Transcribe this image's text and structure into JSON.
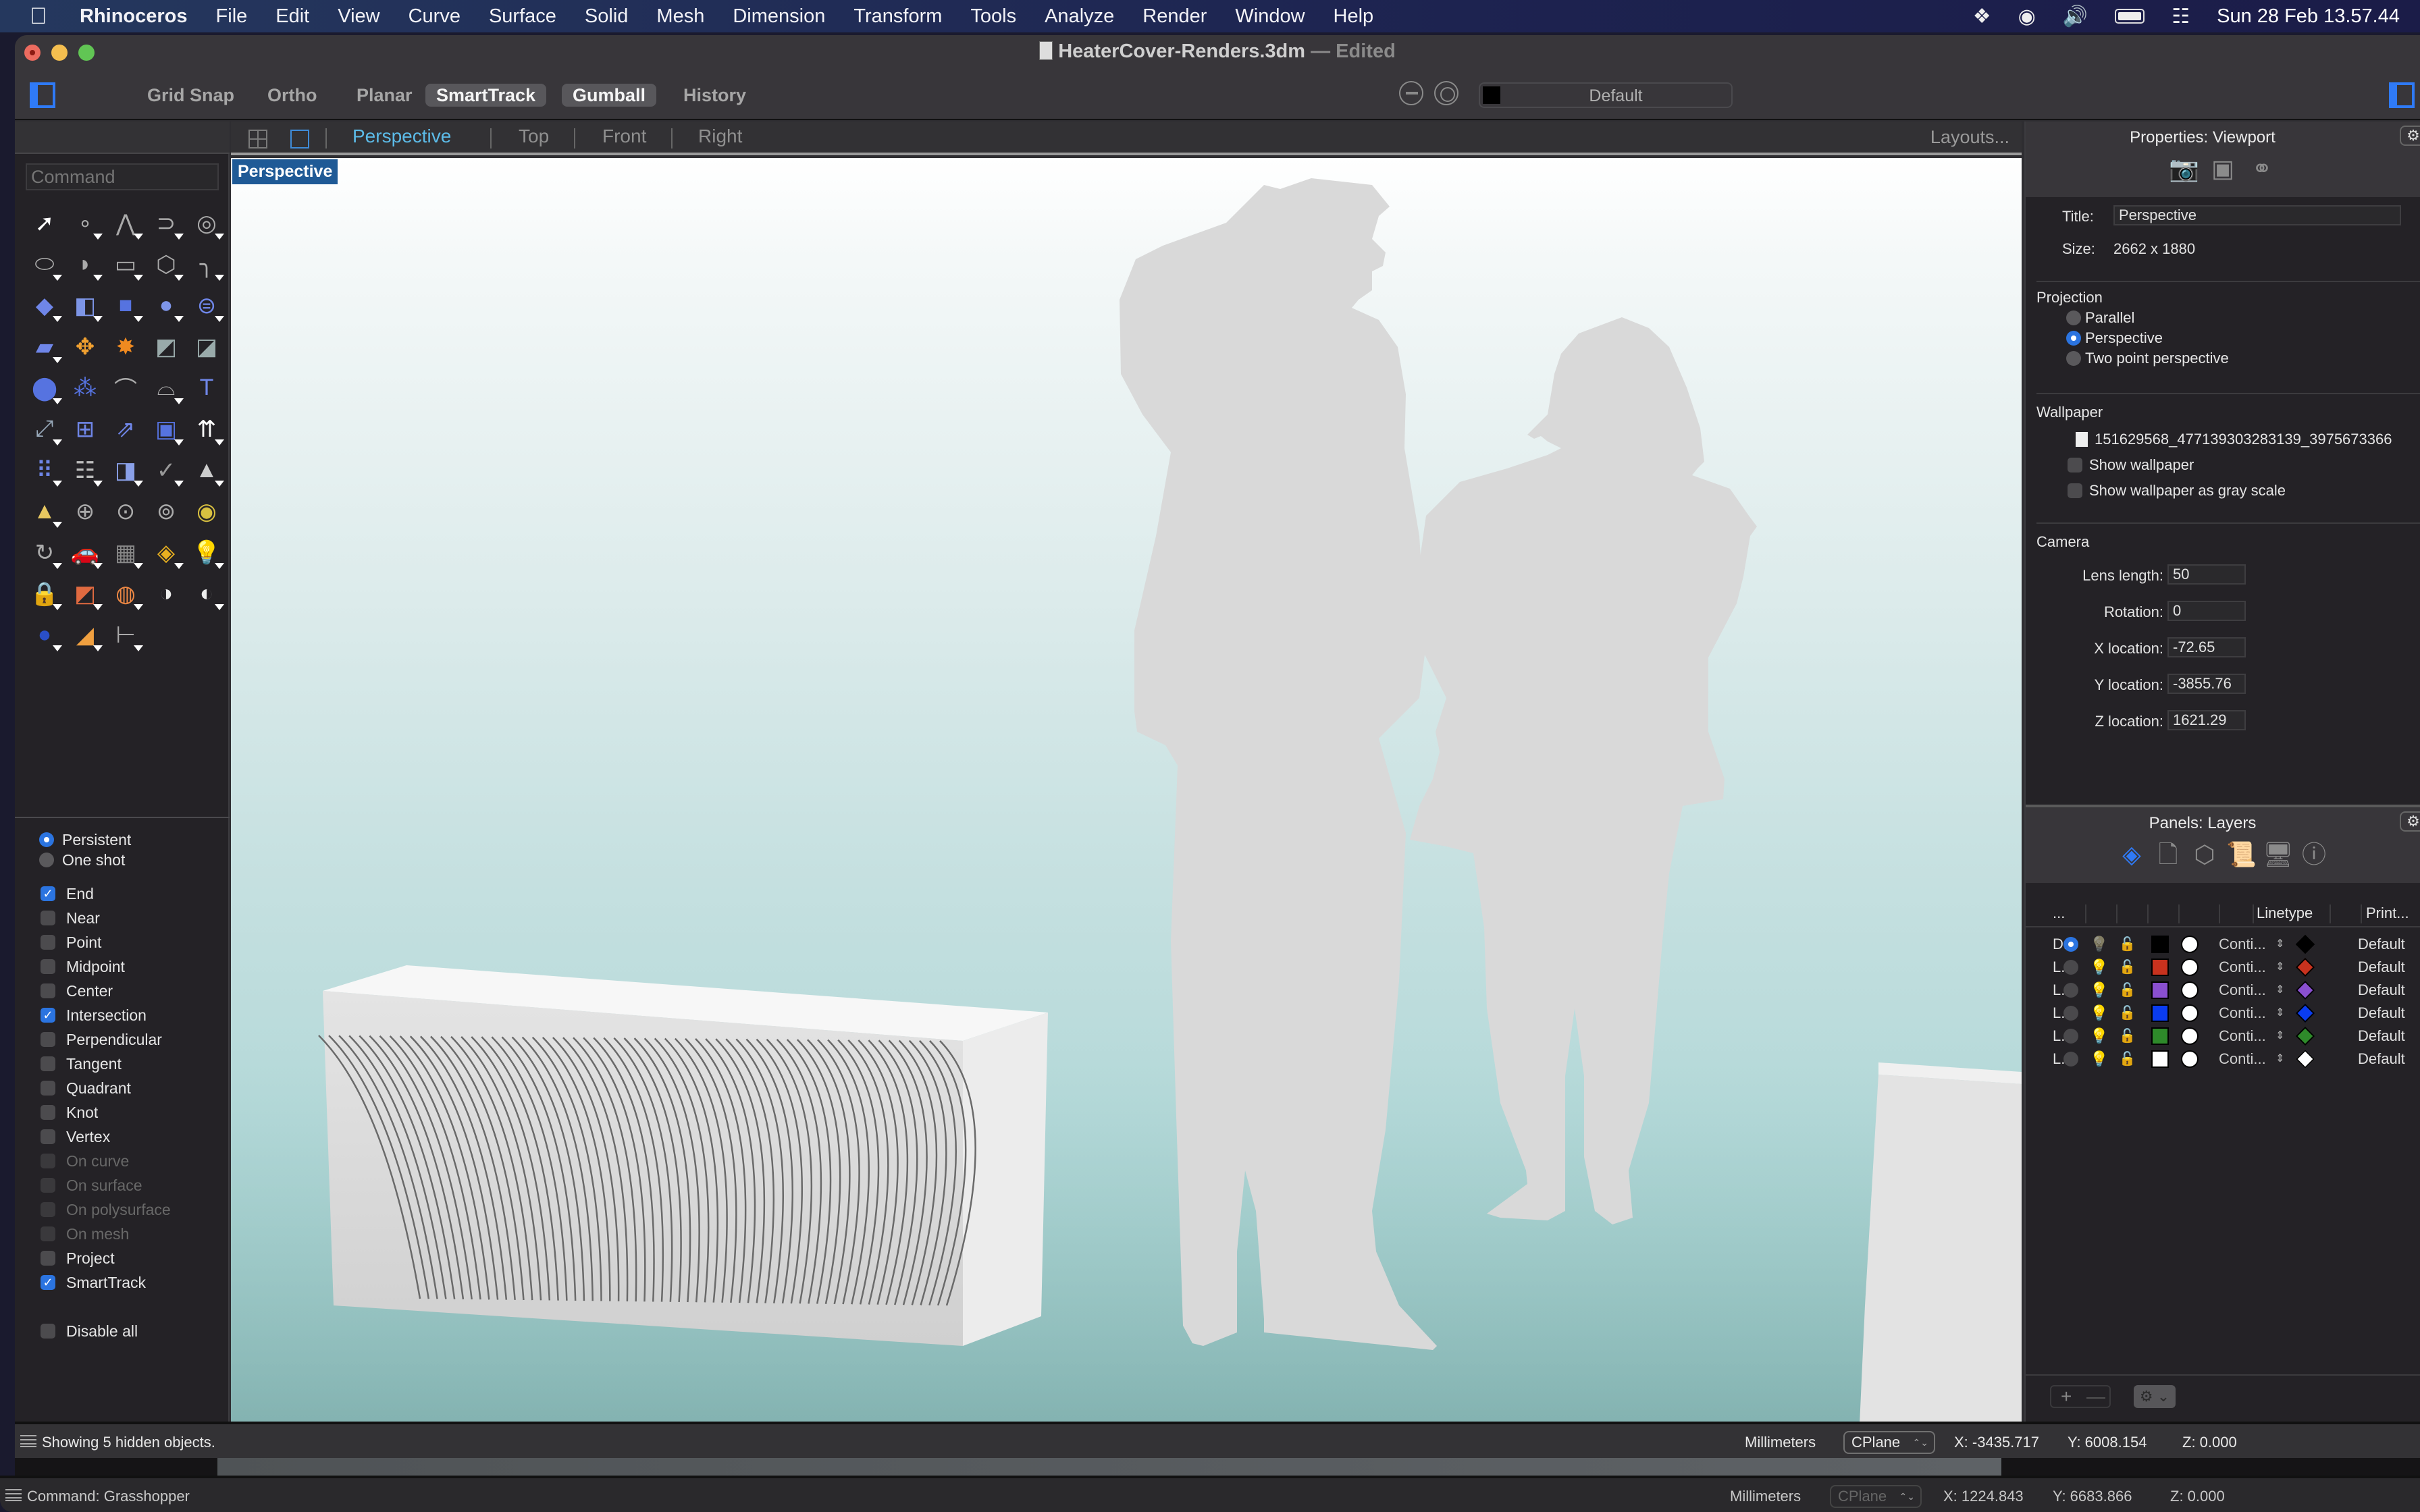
{
  "menubar": {
    "app_name": "Rhinoceros",
    "items": [
      "File",
      "Edit",
      "View",
      "Curve",
      "Surface",
      "Solid",
      "Mesh",
      "Dimension",
      "Transform",
      "Tools",
      "Analyze",
      "Render",
      "Window",
      "Help"
    ],
    "status_icons": [
      "dropbox-icon",
      "hand-mirror-icon",
      "volume-icon",
      "battery-icon",
      "control-center-icon"
    ],
    "clock": "Sun 28 Feb  13.57.44"
  },
  "window": {
    "title": "HeaterCover-Renders.3dm",
    "title_separator": "—",
    "status": "Edited"
  },
  "toolbar": {
    "toggles": [
      {
        "label": "Grid Snap",
        "on": false
      },
      {
        "label": "Ortho",
        "on": false
      },
      {
        "label": "Planar",
        "on": false
      },
      {
        "label": "SmartTrack",
        "on": true
      },
      {
        "label": "Gumball",
        "on": true
      },
      {
        "label": "History",
        "on": false
      }
    ],
    "current_layer": "Default",
    "current_layer_color": "#000000"
  },
  "command": {
    "placeholder": "Command"
  },
  "tool_palette": [
    "select-arrow",
    "point",
    "polyline",
    "curve-interpolate",
    "circle",
    "ellipse",
    "arc",
    "rectangle",
    "polygon",
    "fillet-curve",
    "surface-from-corners",
    "extrude-surface",
    "box",
    "sphere-union",
    "revolve-surface",
    "surface-network",
    "join",
    "explode",
    "trim",
    "split",
    "boolean-union",
    "boolean-split",
    "offset-curve",
    "offset-curve-dotted",
    "text",
    "scale",
    "array",
    "orient",
    "extrude-box",
    "move-up",
    "array-grid",
    "split-vertical",
    "flip",
    "check",
    "solid-primitives",
    "pan-view",
    "zoom-in-out",
    "zoom-window",
    "zoom-extents",
    "zoom-selected",
    "rotate-view",
    "walkabout-car",
    "cplane",
    "properties-shapes",
    "light-bulb",
    "lock",
    "layer-stack",
    "color-wheel",
    "shade-sphere",
    "render-sphere",
    "material-ball",
    "spot-light",
    "dimension"
  ],
  "osnap": {
    "modes": [
      {
        "label": "Persistent",
        "selected": true
      },
      {
        "label": "One shot",
        "selected": false
      }
    ],
    "snaps": [
      {
        "label": "End",
        "checked": true,
        "enabled": true
      },
      {
        "label": "Near",
        "checked": false,
        "enabled": true
      },
      {
        "label": "Point",
        "checked": false,
        "enabled": true
      },
      {
        "label": "Midpoint",
        "checked": false,
        "enabled": true
      },
      {
        "label": "Center",
        "checked": false,
        "enabled": true
      },
      {
        "label": "Intersection",
        "checked": true,
        "enabled": true
      },
      {
        "label": "Perpendicular",
        "checked": false,
        "enabled": true
      },
      {
        "label": "Tangent",
        "checked": false,
        "enabled": true
      },
      {
        "label": "Quadrant",
        "checked": false,
        "enabled": true
      },
      {
        "label": "Knot",
        "checked": false,
        "enabled": true
      },
      {
        "label": "Vertex",
        "checked": false,
        "enabled": true
      },
      {
        "label": "On curve",
        "checked": false,
        "enabled": false
      },
      {
        "label": "On surface",
        "checked": false,
        "enabled": false
      },
      {
        "label": "On polysurface",
        "checked": false,
        "enabled": false
      },
      {
        "label": "On mesh",
        "checked": false,
        "enabled": false
      },
      {
        "label": "Project",
        "checked": false,
        "enabled": true
      },
      {
        "label": "SmartTrack",
        "checked": true,
        "enabled": true
      }
    ],
    "disable_all": {
      "label": "Disable all",
      "checked": false
    }
  },
  "viewport_tabs": {
    "tabs": [
      "Perspective",
      "Top",
      "Front",
      "Right"
    ],
    "active": "Perspective",
    "layouts_label": "Layouts..."
  },
  "viewport": {
    "label": "Perspective",
    "scene_objects": [
      "heater-cover",
      "man-silhouette",
      "woman-silhouette",
      "heater-cover-partial"
    ]
  },
  "properties": {
    "header": "Properties: Viewport",
    "tab_icons": [
      "camera-icon",
      "frame-icon",
      "linked-circles-icon"
    ],
    "title_label": "Title:",
    "title_value": "Perspective",
    "size_label": "Size:",
    "size_value": "2662 x 1880",
    "projection": {
      "heading": "Projection",
      "options": [
        {
          "label": "Parallel",
          "selected": false
        },
        {
          "label": "Perspective",
          "selected": true
        },
        {
          "label": "Two point perspective",
          "selected": false
        }
      ]
    },
    "wallpaper": {
      "heading": "Wallpaper",
      "file": "151629568_477139303283139_3975673366",
      "show_label": "Show wallpaper",
      "show_checked": false,
      "gray_label": "Show wallpaper as gray scale",
      "gray_checked": false
    },
    "camera": {
      "heading": "Camera",
      "fields": [
        {
          "label": "Lens length:",
          "value": "50"
        },
        {
          "label": "Rotation:",
          "value": "0"
        },
        {
          "label": "X location:",
          "value": "-72.65"
        },
        {
          "label": "Y location:",
          "value": "-3855.76"
        },
        {
          "label": "Z location:",
          "value": "1621.29"
        }
      ]
    }
  },
  "layers_panel": {
    "header": "Panels: Layers",
    "tab_icons": [
      "layers-icon",
      "document-icon",
      "cube-icon",
      "scroll-icon",
      "display-icon",
      "help-icon"
    ],
    "columns": [
      "...",
      "",
      "",
      "",
      "",
      "",
      "Linetype",
      "",
      "Print..."
    ],
    "rows": [
      {
        "name": "D...",
        "current": true,
        "on": false,
        "color": "#000000",
        "linetype": "Conti...",
        "print_color": "#000000",
        "print_width": "Default"
      },
      {
        "name": "L...",
        "current": false,
        "on": true,
        "color": "#c8321e",
        "linetype": "Conti...",
        "print_color": "#c8321e",
        "print_width": "Default"
      },
      {
        "name": "L...",
        "current": false,
        "on": true,
        "color": "#8a4fd0",
        "linetype": "Conti...",
        "print_color": "#8a4fd0",
        "print_width": "Default"
      },
      {
        "name": "L...",
        "current": false,
        "on": true,
        "color": "#0a3cf0",
        "linetype": "Conti...",
        "print_color": "#0a3cf0",
        "print_width": "Default"
      },
      {
        "name": "L...",
        "current": false,
        "on": true,
        "color": "#2e8a2a",
        "linetype": "Conti...",
        "print_color": "#2e8a2a",
        "print_width": "Default"
      },
      {
        "name": "L...",
        "current": false,
        "on": true,
        "color": "#ffffff",
        "linetype": "Conti...",
        "print_color": "#ffffff",
        "print_width": "Default"
      }
    ],
    "add_label": "+",
    "remove_label": "—"
  },
  "status_bar": {
    "message": "Showing 5 hidden objects.",
    "units": "Millimeters",
    "cplane": "CPlane",
    "x": "X: -3435.717",
    "y": "Y: 6008.154",
    "z": "Z: 0.000"
  },
  "status_bar_2": {
    "message": "Command: Grasshopper",
    "units": "Millimeters",
    "cplane": "CPlane",
    "x": "X: 1224.843",
    "y": "Y: 6683.866",
    "z": "Z: 0.000"
  },
  "colors": {
    "accent": "#2f7af6",
    "active_tab": "#5cbbe8",
    "viewport_label_bg": "#1f5a96"
  }
}
